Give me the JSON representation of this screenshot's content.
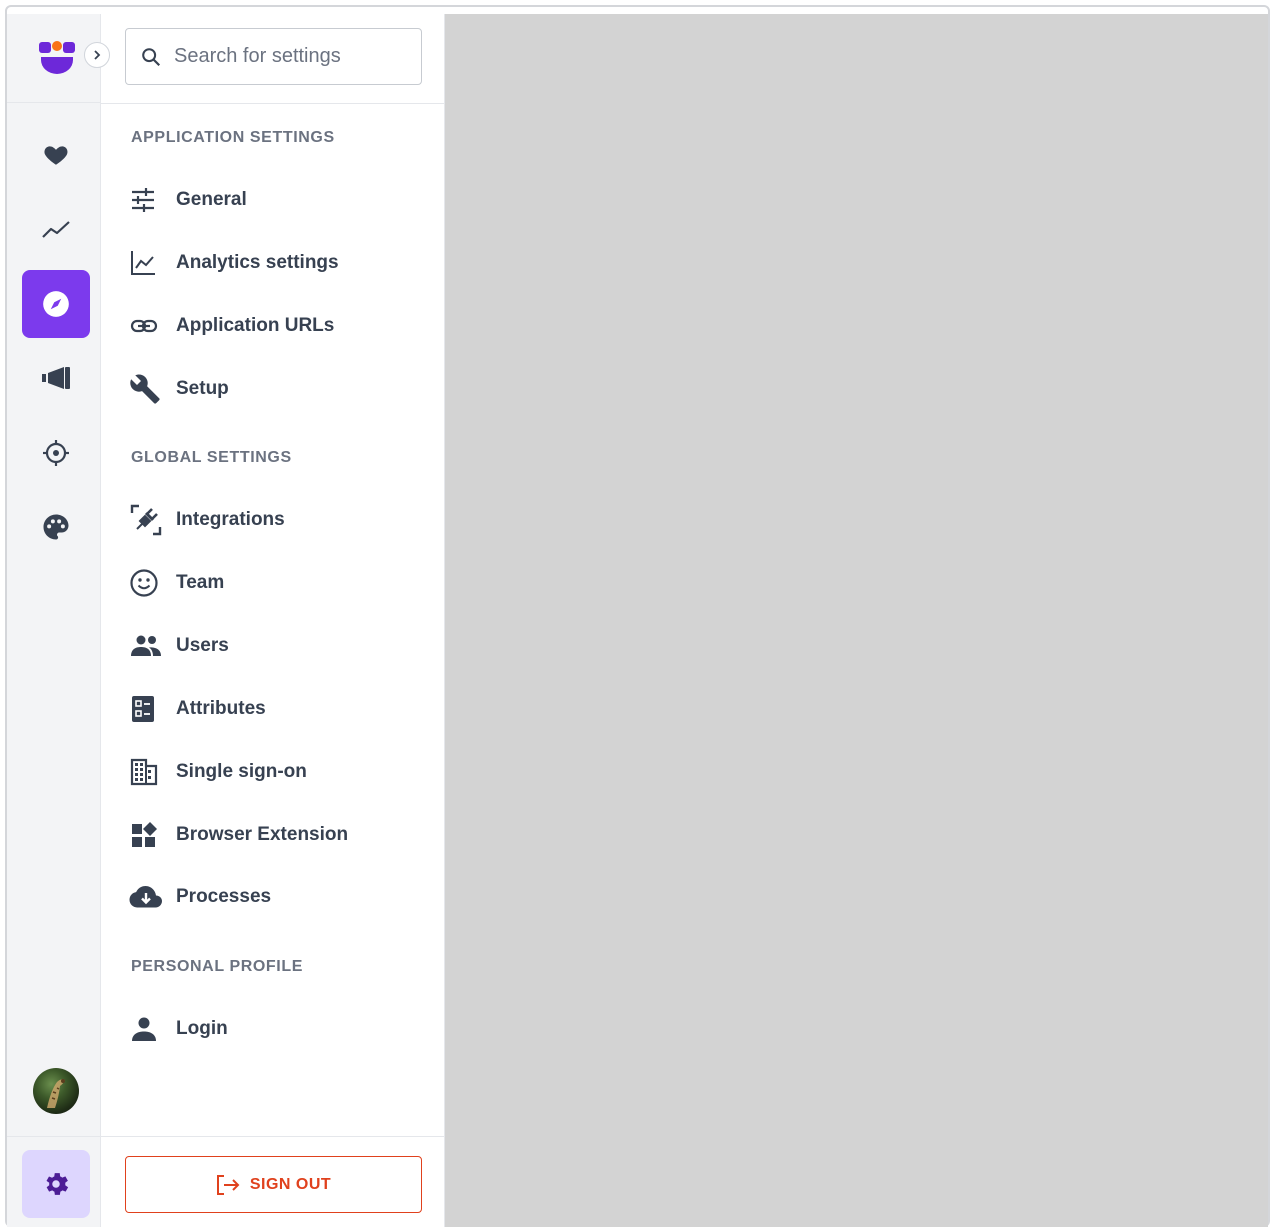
{
  "search": {
    "placeholder": "Search for settings"
  },
  "sections": {
    "application": "APPLICATION SETTINGS",
    "global": "GLOBAL SETTINGS",
    "personal": "PERSONAL PROFILE"
  },
  "menu": {
    "general": "General",
    "analytics": "Analytics settings",
    "app_urls": "Application URLs",
    "setup": "Setup",
    "integrations": "Integrations",
    "team": "Team",
    "users": "Users",
    "attributes": "Attributes",
    "sso": "Single sign-on",
    "browser_extension": "Browser Extension",
    "processes": "Processes",
    "login": "Login"
  },
  "signout": {
    "label": "SIGN OUT"
  },
  "rail": {
    "items": [
      "heart-icon",
      "trending-icon",
      "compass-icon",
      "megaphone-icon",
      "crosshair-icon",
      "palette-icon"
    ],
    "active": "compass-icon"
  },
  "colors": {
    "accent": "#7c3aed",
    "accent_light": "#ddd6fe",
    "danger": "#e0411d",
    "content_bg": "#d3d3d3",
    "icon": "#374151"
  }
}
